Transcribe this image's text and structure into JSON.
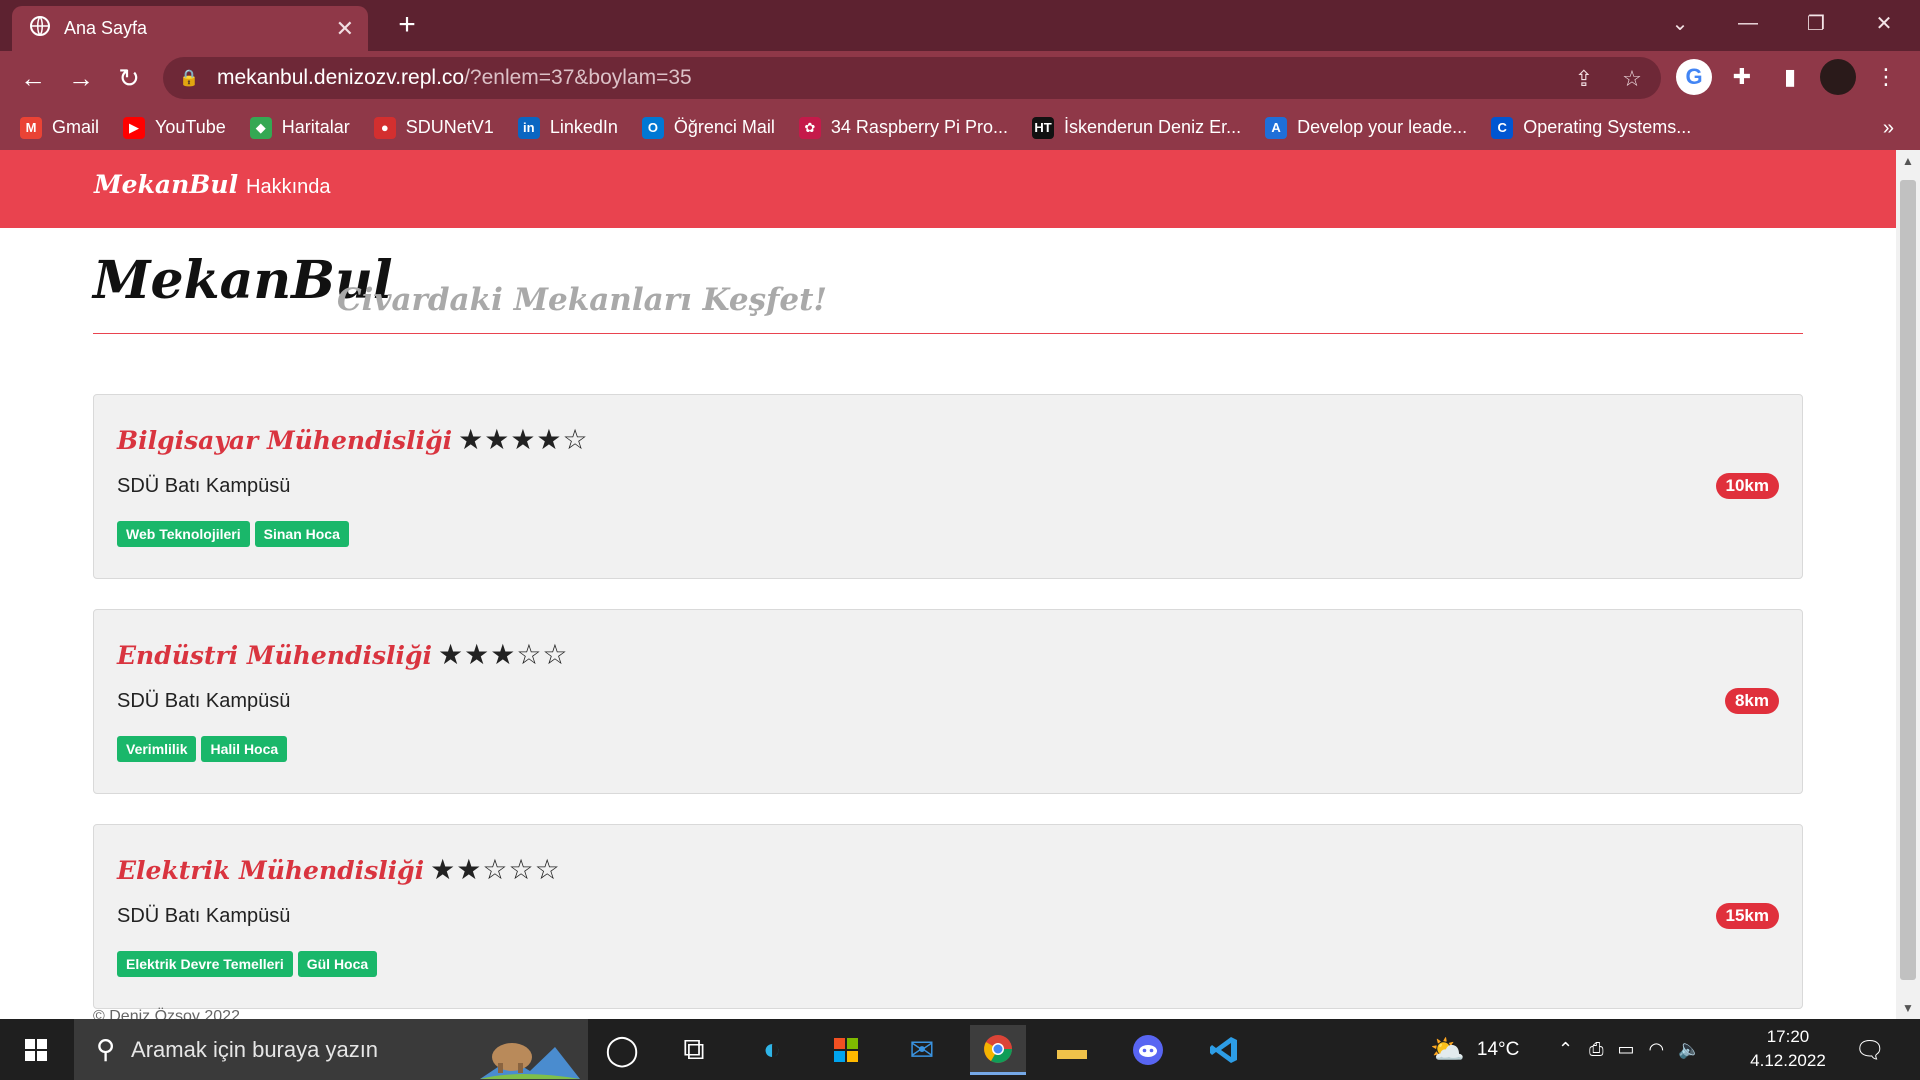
{
  "browser": {
    "tab_title": "Ana Sayfa",
    "url_host": "mekanbul.denizozv.repl.co",
    "url_rest": "/?enlem=37&boylam=35",
    "bookmarks": [
      {
        "label": "Gmail",
        "icon": "gmail-icon",
        "color": "#ea4335",
        "glyph": "M"
      },
      {
        "label": "YouTube",
        "icon": "youtube-icon",
        "color": "#ff0000",
        "glyph": "▶"
      },
      {
        "label": "Haritalar",
        "icon": "maps-icon",
        "color": "#34a853",
        "glyph": "◆"
      },
      {
        "label": "SDUNetV1",
        "icon": "sdu-icon",
        "color": "#d32f2f",
        "glyph": "●"
      },
      {
        "label": "LinkedIn",
        "icon": "linkedin-icon",
        "color": "#0a66c2",
        "glyph": "in"
      },
      {
        "label": "Öğrenci Mail",
        "icon": "outlook-icon",
        "color": "#0078d4",
        "glyph": "O"
      },
      {
        "label": "34 Raspberry Pi Pro...",
        "icon": "raspberry-icon",
        "color": "#c51a4a",
        "glyph": "✿"
      },
      {
        "label": "İskenderun Deniz Er...",
        "icon": "ht-icon",
        "color": "#111111",
        "glyph": "HT"
      },
      {
        "label": "Develop your leade...",
        "icon": "develop-icon",
        "color": "#1e6fd9",
        "glyph": "A"
      },
      {
        "label": "Operating Systems...",
        "icon": "coursera-icon",
        "color": "#0056d2",
        "glyph": "C"
      }
    ]
  },
  "site": {
    "brand": "MekanBul",
    "nav_about": "Hakkında",
    "header_title": "MekanBul",
    "header_tagline": "Civardaki Mekanları Keşfet!",
    "footer": "© Deniz Özsoy 2022"
  },
  "places": [
    {
      "name": "Bilgisayar Mühendisliği",
      "rating": 4,
      "address": "SDÜ Batı Kampüsü",
      "distance": "10km",
      "tags": [
        "Web Teknolojileri",
        "Sinan Hoca"
      ]
    },
    {
      "name": "Endüstri Mühendisliği",
      "rating": 3,
      "address": "SDÜ Batı Kampüsü",
      "distance": "8km",
      "tags": [
        "Verimlilik",
        "Halil Hoca"
      ]
    },
    {
      "name": "Elektrik Mühendisliği",
      "rating": 2,
      "address": "SDÜ Batı Kampüsü",
      "distance": "15km",
      "tags": [
        "Elektrik Devre Temelleri",
        "Gül Hoca"
      ]
    }
  ],
  "taskbar": {
    "search_placeholder": "Aramak için buraya yazın",
    "temperature": "14°C",
    "time": "17:20",
    "date": "4.12.2022"
  },
  "colors": {
    "accent": "#e9434f",
    "title_red": "#d9343f",
    "tag_green": "#1ab76a",
    "browser_frame": "#8f3848"
  }
}
